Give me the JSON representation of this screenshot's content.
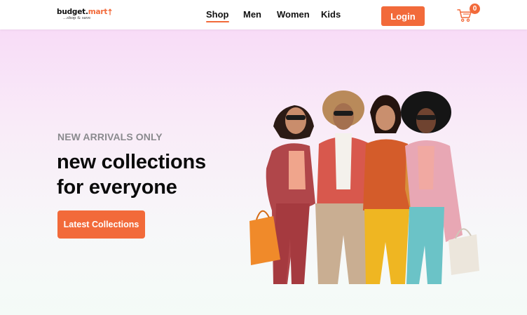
{
  "brand": {
    "name_dark": "budget.",
    "name_accent": "mart",
    "tagline": "...shop & save"
  },
  "nav": {
    "items": [
      {
        "label": "Shop",
        "active": true
      },
      {
        "label": "Men",
        "active": false
      },
      {
        "label": "Women",
        "active": false
      },
      {
        "label": "Kids",
        "active": false
      }
    ]
  },
  "header": {
    "login_label": "Login",
    "cart_icon": "cart-icon",
    "cart_count": "0"
  },
  "hero": {
    "kicker": "NEW ARRIVALS ONLY",
    "headline_line1": "new collections",
    "headline_line2": "for everyone",
    "cta_label": "Latest Collections"
  },
  "colors": {
    "accent": "#f26a3a",
    "hero_top": "#f8dcf7",
    "hero_bottom": "#f4fbf7"
  }
}
